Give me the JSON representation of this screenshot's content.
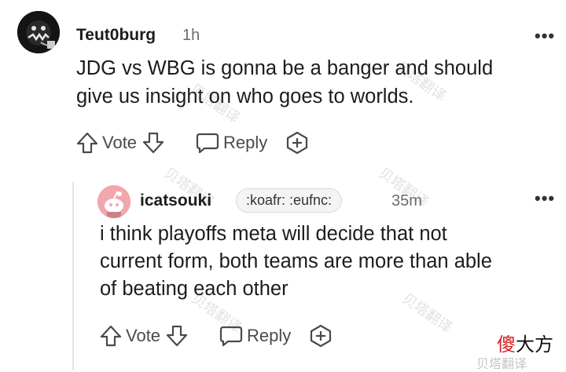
{
  "comments": [
    {
      "username": "Teut0burg",
      "time": "1h",
      "text_line1": "JDG vs WBG is gonna be a banger and should",
      "text_line2": "give us insight on who goes to worlds.",
      "vote_label": "Vote",
      "reply_label": "Reply",
      "more": "•••"
    },
    {
      "username": "icatsouki",
      "flair": ":koafr: :eufnc:",
      "time": "35m",
      "text_line1": "i think playoffs meta will decide that not",
      "text_line2": "current form, both teams are more than able",
      "text_line3": "of beating each other",
      "vote_label": "Vote",
      "reply_label": "Reply",
      "more": "•••"
    }
  ],
  "icons": {
    "upvote": "arrow-up-icon",
    "downvote": "arrow-down-icon",
    "reply": "speech-bubble-icon",
    "award": "award-plus-icon",
    "more": "more-options-icon"
  },
  "watermark": {
    "text": "贝塔翻译",
    "bottom_text": "贝塔翻译"
  },
  "logo": {
    "part1": "傻",
    "part2": "大方"
  },
  "colors": {
    "text": "#1c1c1c",
    "muted": "#6b6b6b",
    "avatar2": "#f0a0a8",
    "logo_red": "#d6201e"
  }
}
